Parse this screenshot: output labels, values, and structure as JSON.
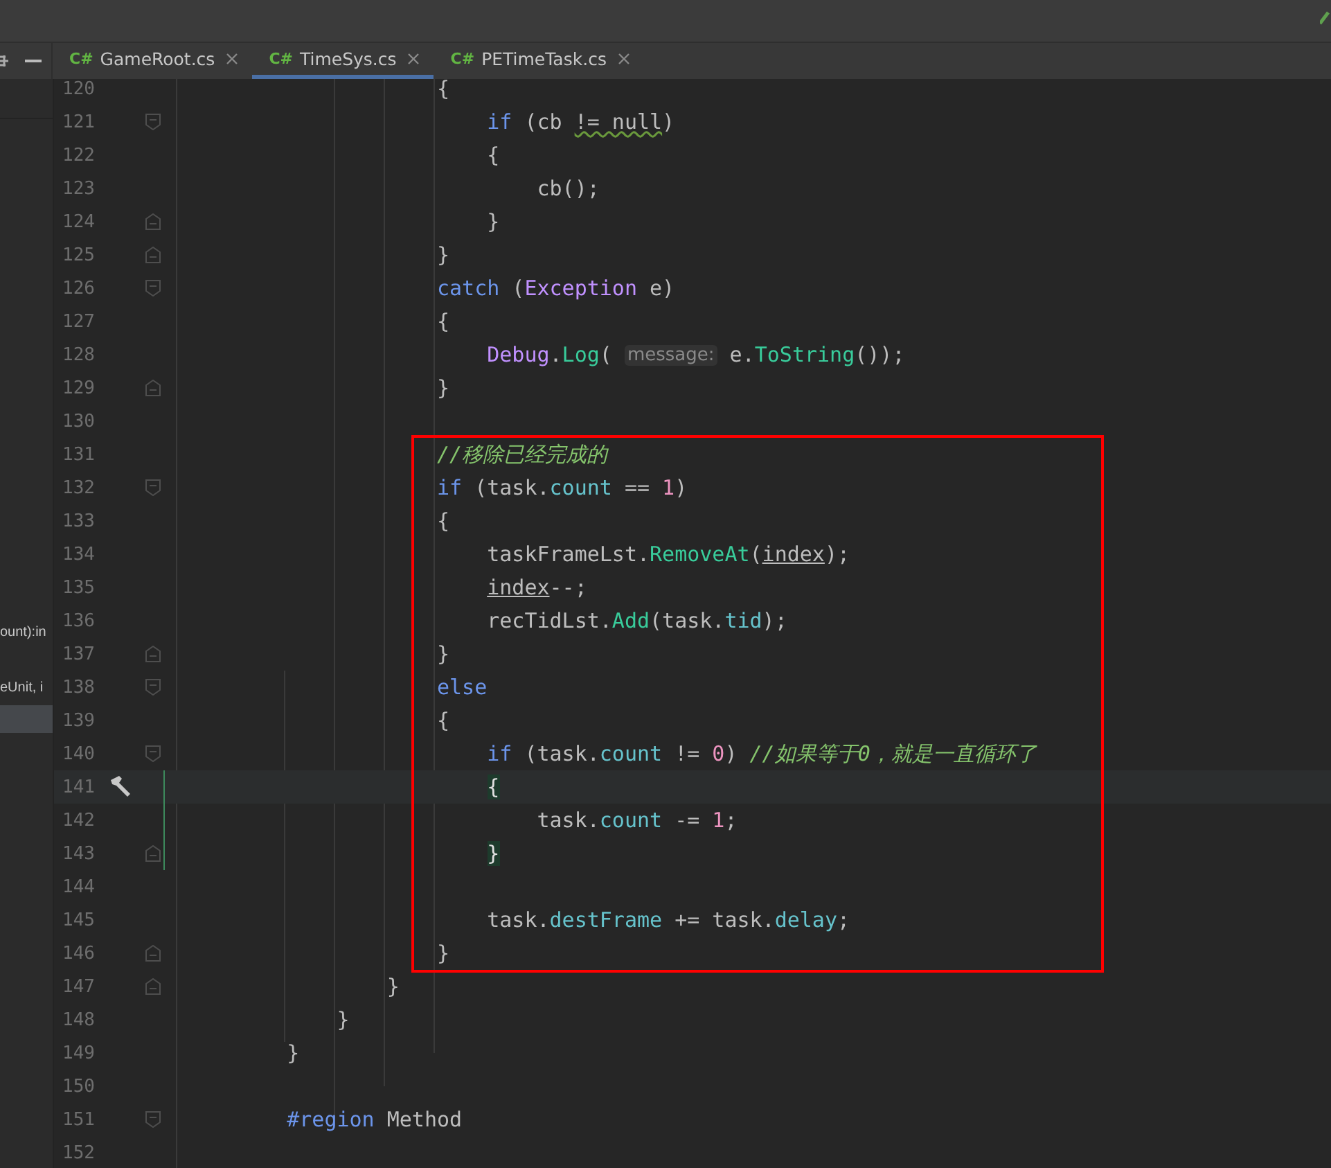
{
  "tabs": [
    {
      "icon_text": "C#",
      "label": "GameRoot.cs",
      "selected": false
    },
    {
      "icon_text": "C#",
      "label": "TimeSys.cs",
      "selected": true
    },
    {
      "icon_text": "C#",
      "label": "PETimeTask.cs",
      "selected": false
    }
  ],
  "sidebar": {
    "items": [
      {
        "text": "ount):in",
        "selected": false
      },
      {
        "text": "eUnit, i",
        "selected": false
      },
      {
        "selected": true
      }
    ]
  },
  "lines": [
    {
      "children": [
        {
          "children": [
            {
              "children": [
                {
                  "children": [
                    {
                      "number": "120",
                      "tokens": [
                        {
                          "kind": "plain",
                          "text": "{"
                        }
                      ],
                      "children": [
                        {
                          "number": "121",
                          "fold_start": true,
                          "tokens": [
                            {
                              "kind": "keyword",
                              "text": "if"
                            },
                            {
                              "kind": "plain",
                              "text": " (cb "
                            },
                            {
                              "kind": "plain",
                              "text": "!= null",
                              "warning": true
                            },
                            {
                              "kind": "plain",
                              "text": ")"
                            }
                          ]
                        },
                        {
                          "number": "122",
                          "tokens": [
                            {
                              "kind": "plain",
                              "text": "{"
                            }
                          ],
                          "children": [
                            {
                              "number": "123",
                              "tokens": [
                                {
                                  "kind": "plain",
                                  "text": "cb();"
                                }
                              ]
                            }
                          ]
                        },
                        {
                          "number": "124",
                          "fold_end": true,
                          "tokens": [
                            {
                              "kind": "plain",
                              "text": "}"
                            }
                          ]
                        }
                      ]
                    },
                    {
                      "number": "125",
                      "fold_end": true,
                      "tokens": [
                        {
                          "kind": "plain",
                          "text": "}"
                        }
                      ]
                    },
                    {
                      "number": "126",
                      "fold_start": true,
                      "tokens": [
                        {
                          "kind": "keyword",
                          "text": "catch"
                        },
                        {
                          "kind": "plain",
                          "text": " ("
                        },
                        {
                          "kind": "class",
                          "text": "Exception"
                        },
                        {
                          "kind": "plain",
                          "text": " e)"
                        }
                      ]
                    },
                    {
                      "number": "127",
                      "tokens": [
                        {
                          "kind": "plain",
                          "text": "{"
                        }
                      ],
                      "children": [
                        {
                          "number": "128",
                          "tokens": [
                            {
                              "kind": "class",
                              "text": "Debug"
                            },
                            {
                              "kind": "plain",
                              "text": "."
                            },
                            {
                              "kind": "method",
                              "text": "Log"
                            },
                            {
                              "kind": "plain",
                              "text": "( "
                            },
                            {
                              "kind": "hint",
                              "text": "message:"
                            },
                            {
                              "kind": "plain",
                              "text": " e."
                            },
                            {
                              "kind": "method",
                              "text": "ToString"
                            },
                            {
                              "kind": "plain",
                              "text": "());"
                            }
                          ]
                        }
                      ]
                    },
                    {
                      "number": "129",
                      "fold_end": true,
                      "tokens": [
                        {
                          "kind": "plain",
                          "text": "}"
                        }
                      ]
                    },
                    {
                      "number": "130"
                    },
                    {
                      "kind": "highlight_box",
                      "items": [
                        {
                          "number": "131",
                          "tokens": [
                            {
                              "kind": "comment",
                              "text": "//移除已经完成的"
                            }
                          ]
                        },
                        {
                          "number": "132",
                          "fold_start": true,
                          "tokens": [
                            {
                              "kind": "keyword",
                              "text": "if"
                            },
                            {
                              "kind": "plain",
                              "text": " (task."
                            },
                            {
                              "kind": "field",
                              "text": "count"
                            },
                            {
                              "kind": "plain",
                              "text": " == "
                            },
                            {
                              "kind": "number",
                              "text": "1"
                            },
                            {
                              "kind": "plain",
                              "text": ")"
                            }
                          ]
                        },
                        {
                          "number": "133",
                          "tokens": [
                            {
                              "kind": "plain",
                              "text": "{"
                            }
                          ],
                          "children": [
                            {
                              "number": "134",
                              "tokens": [
                                {
                                  "kind": "plain",
                                  "text": "taskFrameLst."
                                },
                                {
                                  "kind": "method",
                                  "text": "RemoveAt"
                                },
                                {
                                  "kind": "plain",
                                  "text": "("
                                },
                                {
                                  "kind": "plain",
                                  "text": "index",
                                  "underline": true
                                },
                                {
                                  "kind": "plain",
                                  "text": ");"
                                }
                              ]
                            },
                            {
                              "number": "135",
                              "tokens": [
                                {
                                  "kind": "plain",
                                  "text": "index",
                                  "underline": true
                                },
                                {
                                  "kind": "plain",
                                  "text": "--;"
                                }
                              ]
                            },
                            {
                              "number": "136",
                              "tokens": [
                                {
                                  "kind": "plain",
                                  "text": "recTidLst."
                                },
                                {
                                  "kind": "method",
                                  "text": "Add"
                                },
                                {
                                  "kind": "plain",
                                  "text": "(task."
                                },
                                {
                                  "kind": "field",
                                  "text": "tid"
                                },
                                {
                                  "kind": "plain",
                                  "text": ");"
                                }
                              ]
                            }
                          ]
                        },
                        {
                          "number": "137",
                          "fold_end": true,
                          "tokens": [
                            {
                              "kind": "plain",
                              "text": "}"
                            }
                          ]
                        },
                        {
                          "number": "138",
                          "fold_start": true,
                          "tokens": [
                            {
                              "kind": "keyword",
                              "text": "else"
                            }
                          ]
                        },
                        {
                          "number": "139",
                          "tokens": [
                            {
                              "kind": "plain",
                              "text": "{"
                            }
                          ],
                          "children": [
                            {
                              "number": "140",
                              "fold_start": true,
                              "tokens": [
                                {
                                  "kind": "keyword",
                                  "text": "if"
                                },
                                {
                                  "kind": "plain",
                                  "text": " (task."
                                },
                                {
                                  "kind": "field",
                                  "text": "count"
                                },
                                {
                                  "kind": "plain",
                                  "text": " != "
                                },
                                {
                                  "kind": "number",
                                  "text": "0"
                                },
                                {
                                  "kind": "plain",
                                  "text": ") "
                                },
                                {
                                  "kind": "comment",
                                  "text": "//如果等于0，就是一直循环了"
                                }
                              ]
                            },
                            {
                              "number": "141",
                              "current": true,
                              "changed": true,
                              "tokens": [
                                {
                                  "kind": "brace_match",
                                  "text": "{"
                                }
                              ],
                              "children": [
                                {
                                  "number": "142",
                                  "changed": true,
                                  "tokens": [
                                    {
                                      "kind": "plain",
                                      "text": "task."
                                    },
                                    {
                                      "kind": "field",
                                      "text": "count"
                                    },
                                    {
                                      "kind": "plain",
                                      "text": " -= "
                                    },
                                    {
                                      "kind": "number",
                                      "text": "1"
                                    },
                                    {
                                      "kind": "plain",
                                      "text": ";"
                                    }
                                  ]
                                }
                              ]
                            },
                            {
                              "number": "143",
                              "changed": true,
                              "fold_end": true,
                              "tokens": [
                                {
                                  "kind": "brace_match",
                                  "text": "}"
                                }
                              ]
                            },
                            {
                              "number": "144"
                            },
                            {
                              "number": "145",
                              "tokens": [
                                {
                                  "kind": "plain",
                                  "text": "task."
                                },
                                {
                                  "kind": "field",
                                  "text": "destFrame"
                                },
                                {
                                  "kind": "plain",
                                  "text": " += task."
                                },
                                {
                                  "kind": "field",
                                  "text": "delay"
                                },
                                {
                                  "kind": "plain",
                                  "text": ";"
                                }
                              ]
                            }
                          ]
                        },
                        {
                          "number": "146",
                          "fold_end": true,
                          "tokens": [
                            {
                              "kind": "plain",
                              "text": "}"
                            }
                          ]
                        }
                      ]
                    }
                  ]
                },
                {
                  "number": "147",
                  "fold_end": true,
                  "tokens": [
                    {
                      "kind": "plain",
                      "text": "}"
                    }
                  ]
                }
              ]
            },
            {
              "number": "148",
              "tokens": [
                {
                  "kind": "plain",
                  "text": "}"
                }
              ]
            }
          ]
        },
        {
          "number": "149",
          "tokens": [
            {
              "kind": "plain",
              "text": "}"
            }
          ]
        },
        {
          "number": "150"
        },
        {
          "number": "151",
          "fold_start": true,
          "tokens": [
            {
              "kind": "keyword",
              "text": "#region"
            },
            {
              "kind": "plain",
              "text": " Method"
            }
          ]
        },
        {
          "number": "152"
        }
      ]
    }
  ]
}
